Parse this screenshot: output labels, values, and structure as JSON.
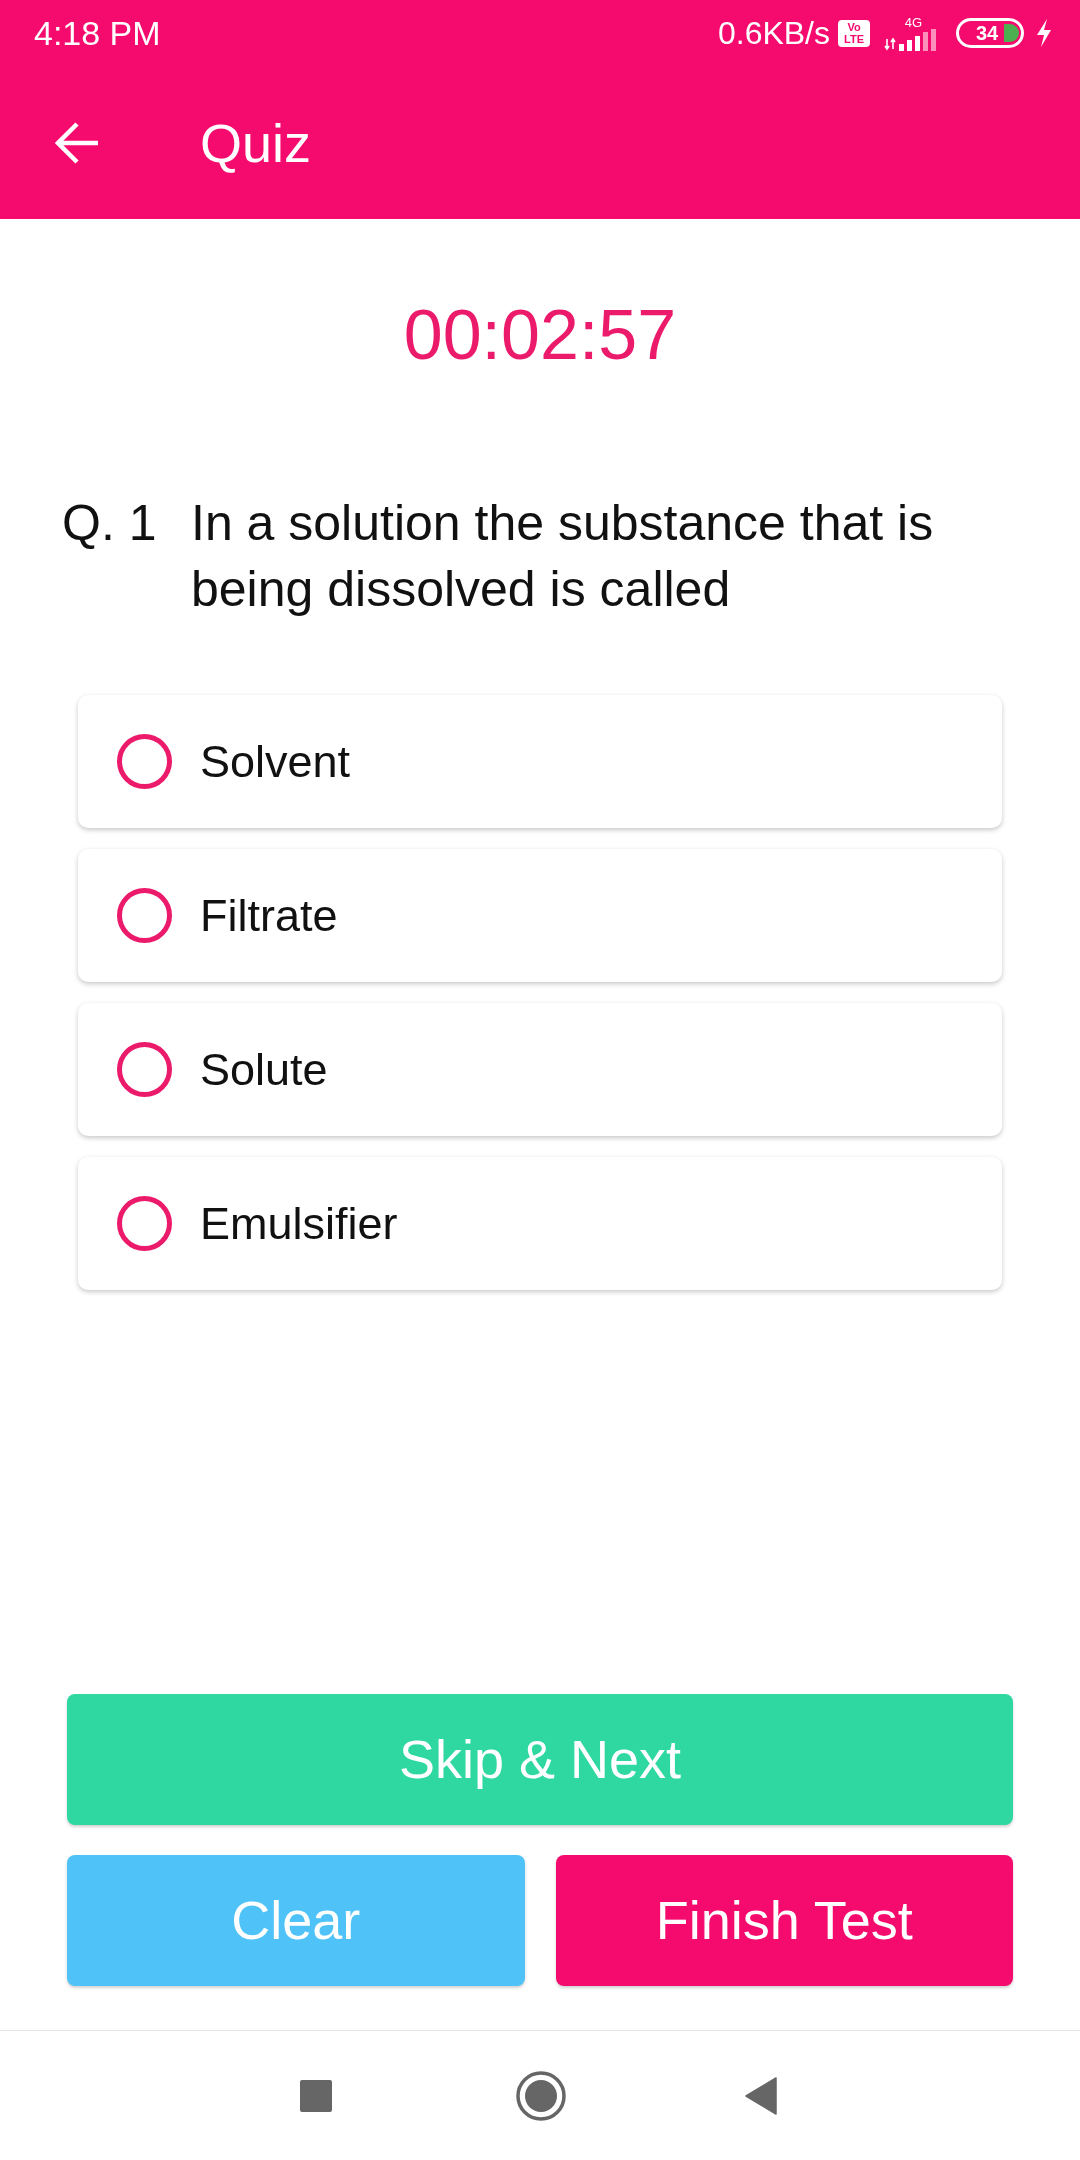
{
  "status_bar": {
    "time": "4:18 PM",
    "network_speed": "0.6KB/s",
    "volte_badge": "Vo LTE",
    "network_type": "4G",
    "battery_percent": "34",
    "charging": true
  },
  "app_bar": {
    "title": "Quiz"
  },
  "timer": "00:02:57",
  "question": {
    "number": "Q. 1",
    "text": "In a solution the substance that is being dissolved is called"
  },
  "options": [
    {
      "label": "Solvent",
      "selected": false
    },
    {
      "label": "Filtrate",
      "selected": false
    },
    {
      "label": "Solute",
      "selected": false
    },
    {
      "label": "Emulsifier",
      "selected": false
    }
  ],
  "actions": [
    {
      "label": "Skip & Next",
      "kind": "skip"
    },
    {
      "label": "Clear",
      "kind": "clear"
    },
    {
      "label": "Finish Test",
      "kind": "finish"
    }
  ]
}
